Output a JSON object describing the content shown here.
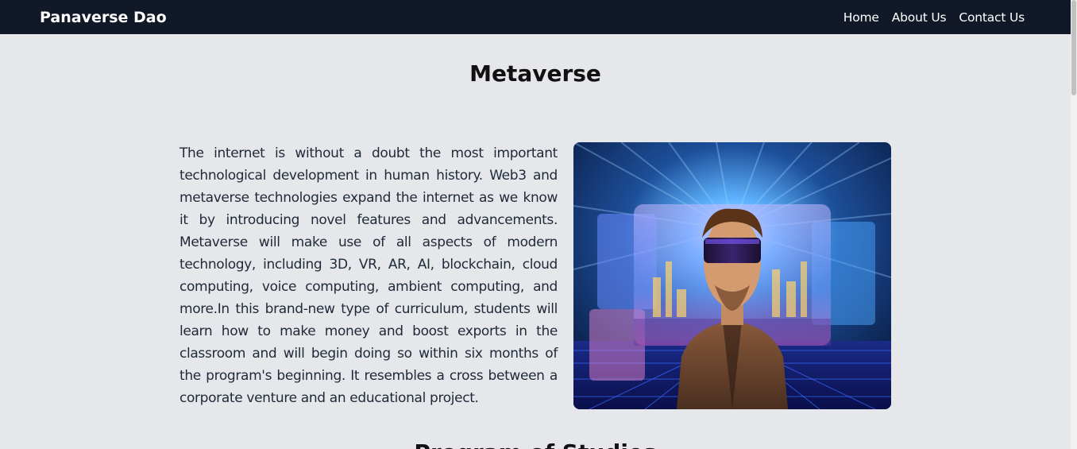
{
  "nav": {
    "brand": "Panaverse Dao",
    "links": [
      "Home",
      "About Us",
      "Contact Us"
    ]
  },
  "main": {
    "title": "Metaverse",
    "description": "The internet is without a doubt the most important technological development in human history. Web3 and metaverse technologies expand the internet as we know it by introducing novel features and advancements. Metaverse will make use of all aspects of modern technology, including 3D, VR, AR, AI, blockchain, cloud computing, voice computing, ambient computing, and more.In this brand-new type of curriculum, students will learn how to make money and boost exports in the classroom and will begin doing so within six months of the program's beginning. It resembles a cross between a corporate venture and an educational project.",
    "next_section_title": "Program of Studies"
  },
  "colors": {
    "navbar": "#111827",
    "background": "#e5e7eb"
  }
}
